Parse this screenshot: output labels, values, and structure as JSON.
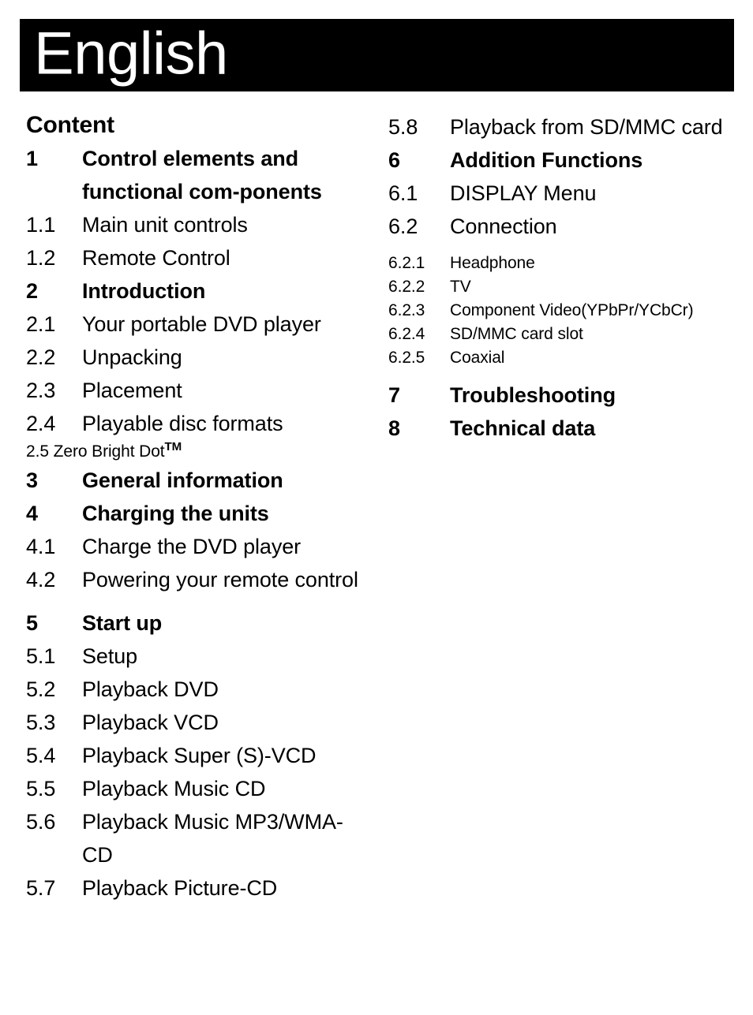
{
  "banner": {
    "title": "English",
    "background": "#000000",
    "text_color": "#ffffff"
  },
  "content_heading": "Content",
  "left_column": [
    {
      "num": "1",
      "label": "Control elements and functional com-ponents",
      "bold": true
    },
    {
      "num": "1.1",
      "label": "Main unit controls",
      "bold": false
    },
    {
      "num": "1.2",
      "label": "Remote Control",
      "bold": false
    },
    {
      "num": "2",
      "label": "Introduction",
      "bold": true
    },
    {
      "num": "2.1",
      "label": "Your portable DVD player",
      "bold": false
    },
    {
      "num": "2.2",
      "label": "Unpacking",
      "bold": false
    },
    {
      "num": "2.3",
      "label": "Placement",
      "bold": false
    },
    {
      "num": "2.4",
      "label": "Playable disc formats",
      "bold": false
    },
    {
      "num": "2.5",
      "label": "Zero Bright Dot",
      "trademark": "TM",
      "bold": false
    },
    {
      "num": "3",
      "label": "General information",
      "bold": true
    },
    {
      "num": "4",
      "label": "Charging the units",
      "bold": true
    },
    {
      "num": "4.1",
      "label": "Charge the DVD player",
      "bold": false
    },
    {
      "num": "4.2",
      "label": "Powering your remote control",
      "bold": false
    },
    {
      "num": "5",
      "label": "Start up",
      "bold": true
    },
    {
      "num": "5.1",
      "label": "Setup",
      "bold": false
    },
    {
      "num": "5.2",
      "label": "Playback DVD",
      "bold": false
    },
    {
      "num": "5.3",
      "label": "Playback VCD",
      "bold": false
    },
    {
      "num": "5.4",
      "label": "Playback Super (S)-VCD",
      "bold": false
    },
    {
      "num": "5.5",
      "label": "Playback Music CD",
      "bold": false
    },
    {
      "num": "5.6",
      "label": "Playback Music MP3/WMA-CD",
      "bold": false
    },
    {
      "num": "5.7",
      "label": "Playback Picture-CD",
      "bold": false
    }
  ],
  "right_column": [
    {
      "num": "5.8",
      "label": "Playback from SD/MMC card",
      "bold": false
    },
    {
      "num": "6",
      "label": "Addition Functions",
      "bold": true
    },
    {
      "num": "6.1",
      "label": "DISPLAY Menu",
      "bold": false
    },
    {
      "num": "6.2",
      "label": "Connection",
      "bold": false
    },
    {
      "num": "6.2.1",
      "label": "Headphone",
      "bold": false
    },
    {
      "num": "6.2.2",
      "label": "TV",
      "bold": false
    },
    {
      "num": "6.2.3",
      "label": "Component Video(YPbPr/YCbCr)",
      "bold": false
    },
    {
      "num": "6.2.4",
      "label": "SD/MMC card slot",
      "bold": false
    },
    {
      "num": "6.2.5",
      "label": "Coaxial",
      "bold": false
    },
    {
      "num": "7",
      "label": "Troubleshooting",
      "bold": true
    },
    {
      "num": "8",
      "label": "Technical data",
      "bold": true
    }
  ]
}
